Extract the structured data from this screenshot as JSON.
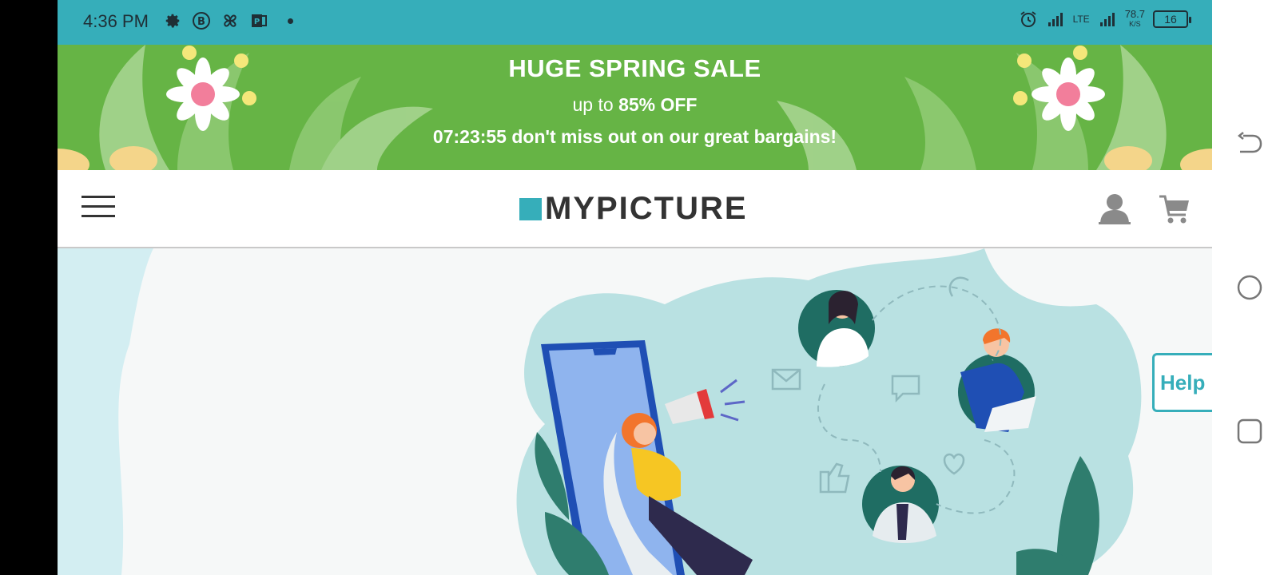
{
  "status_bar": {
    "time": "4:36 PM",
    "network_label": "LTE",
    "speed_value": "78.7",
    "speed_unit": "K/S",
    "battery": "16",
    "left_icons": [
      "gear-icon",
      "b-app-icon",
      "pinwheel-icon",
      "powerpoint-icon"
    ],
    "right_icons": [
      "alarm-icon",
      "signal-icon",
      "lte-signal-icon"
    ]
  },
  "promo": {
    "title": "HUGE SPRING SALE",
    "subtitle_prefix": "up to",
    "subtitle_highlight": "85% OFF",
    "countdown": "07:23:55",
    "message": "don't miss out on our great bargains!",
    "background_color": "#66b445"
  },
  "header": {
    "logo_text": "MYPICTURE",
    "brand_color": "#36aeba",
    "icons": [
      "hamburger-menu-icon",
      "account-icon",
      "cart-icon"
    ]
  },
  "help": {
    "label": "Help"
  },
  "android_nav": {
    "buttons": [
      "back-icon",
      "home-icon",
      "recents-icon"
    ]
  }
}
